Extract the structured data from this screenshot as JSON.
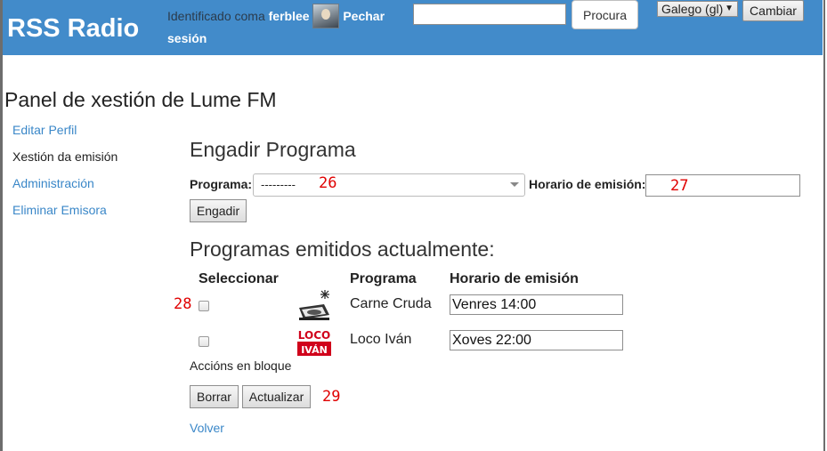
{
  "header": {
    "brand": "RSS Radio",
    "login_prefix": "Identificado coma",
    "username": "ferblee",
    "logout": "Pechar sesión",
    "search_button": "Procura",
    "language": "Galego (gl)",
    "change_button": "Cambiar",
    "header_color": "#428bca"
  },
  "page_title": "Panel de xestión de Lume FM",
  "sidebar": {
    "items": [
      {
        "label": "Editar Perfil",
        "active": false
      },
      {
        "label": "Xestión da emisión",
        "active": true
      },
      {
        "label": "Administración",
        "active": false
      },
      {
        "label": "Eliminar Emisora",
        "active": false
      }
    ]
  },
  "add_program": {
    "heading": "Engadir Programa",
    "program_label": "Programa:",
    "program_selected": "---------",
    "schedule_label": "Horario de emisión:",
    "schedule_value": "",
    "add_button": "Engadir"
  },
  "current": {
    "heading": "Programas emitidos actualmente:",
    "columns": [
      "Seleccionar",
      "Programa",
      "Horario de emisión"
    ],
    "rows": [
      {
        "program": "Carne Cruda",
        "schedule": "Venres 14:00",
        "logo": "carne-cruda-logo",
        "logo_text": ""
      },
      {
        "program": "Loco Iván",
        "schedule": "Xoves 22:00",
        "logo": "loco-ivan-logo",
        "logo_text": "LOCO IVÁN"
      }
    ],
    "bulk_label": "Accións en bloque",
    "delete_button": "Borrar",
    "update_button": "Actualizar",
    "back_link": "Volver"
  },
  "annotations": [
    "26",
    "27",
    "28",
    "29"
  ]
}
